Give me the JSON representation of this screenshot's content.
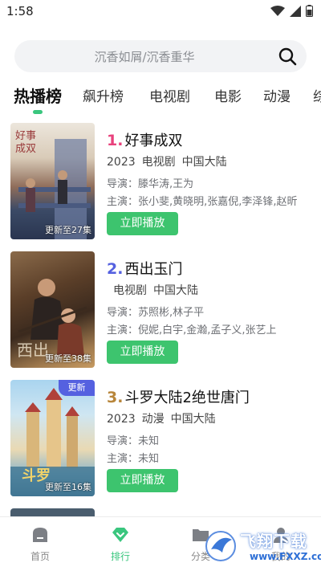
{
  "status": {
    "time": "1:58"
  },
  "search": {
    "placeholder": "沉香如屑/沉香重华"
  },
  "tabs": [
    {
      "label": "热播榜",
      "active": true
    },
    {
      "label": "飙升榜",
      "active": false
    },
    {
      "label": "电视剧",
      "active": false
    },
    {
      "label": "电影",
      "active": false
    },
    {
      "label": "动漫",
      "active": false
    },
    {
      "label": "综",
      "active": false
    }
  ],
  "items": [
    {
      "rank": "1.",
      "rank_color": "#e8417c",
      "title": "好事成双",
      "year": "2023",
      "genre": "电视剧",
      "region": "中国大陆",
      "director": "导演：滕华涛,王为",
      "cast": "主演：张小斐,黄晓明,张嘉倪,李泽锋,赵昕",
      "poster_caption": "更新至27集",
      "play_label": "立即播放"
    },
    {
      "rank": "2.",
      "rank_color": "#5561e0",
      "title": "西出玉门",
      "year": "",
      "genre": "电视剧",
      "region": "中国大陆",
      "director": "导演：苏照彬,林子平",
      "cast": "主演：倪妮,白宇,金瀚,孟子义,张艺上",
      "poster_caption": "更新至38集",
      "play_label": "立即播放"
    },
    {
      "rank": "3.",
      "rank_color": "#b8863b",
      "title": "斗罗大陆2绝世唐门",
      "year": "2023",
      "genre": "动漫",
      "region": "中国大陆",
      "director": "导演：未知",
      "cast": "主演：未知",
      "poster_caption": "更新至16集",
      "badge": "更新",
      "play_label": "立即播放"
    }
  ],
  "nav": [
    {
      "label": "首页",
      "icon": "home-icon",
      "active": false
    },
    {
      "label": "排行",
      "icon": "diamond-icon",
      "active": true
    },
    {
      "label": "分类",
      "icon": "folder-icon",
      "active": false
    },
    {
      "label": "我的",
      "icon": "user-icon",
      "active": false
    }
  ],
  "watermark": {
    "text": "飞翔下载",
    "url": "www.FXXZ.com"
  },
  "colors": {
    "accent": "#3ac67e",
    "play_button": "#3dc46e"
  }
}
